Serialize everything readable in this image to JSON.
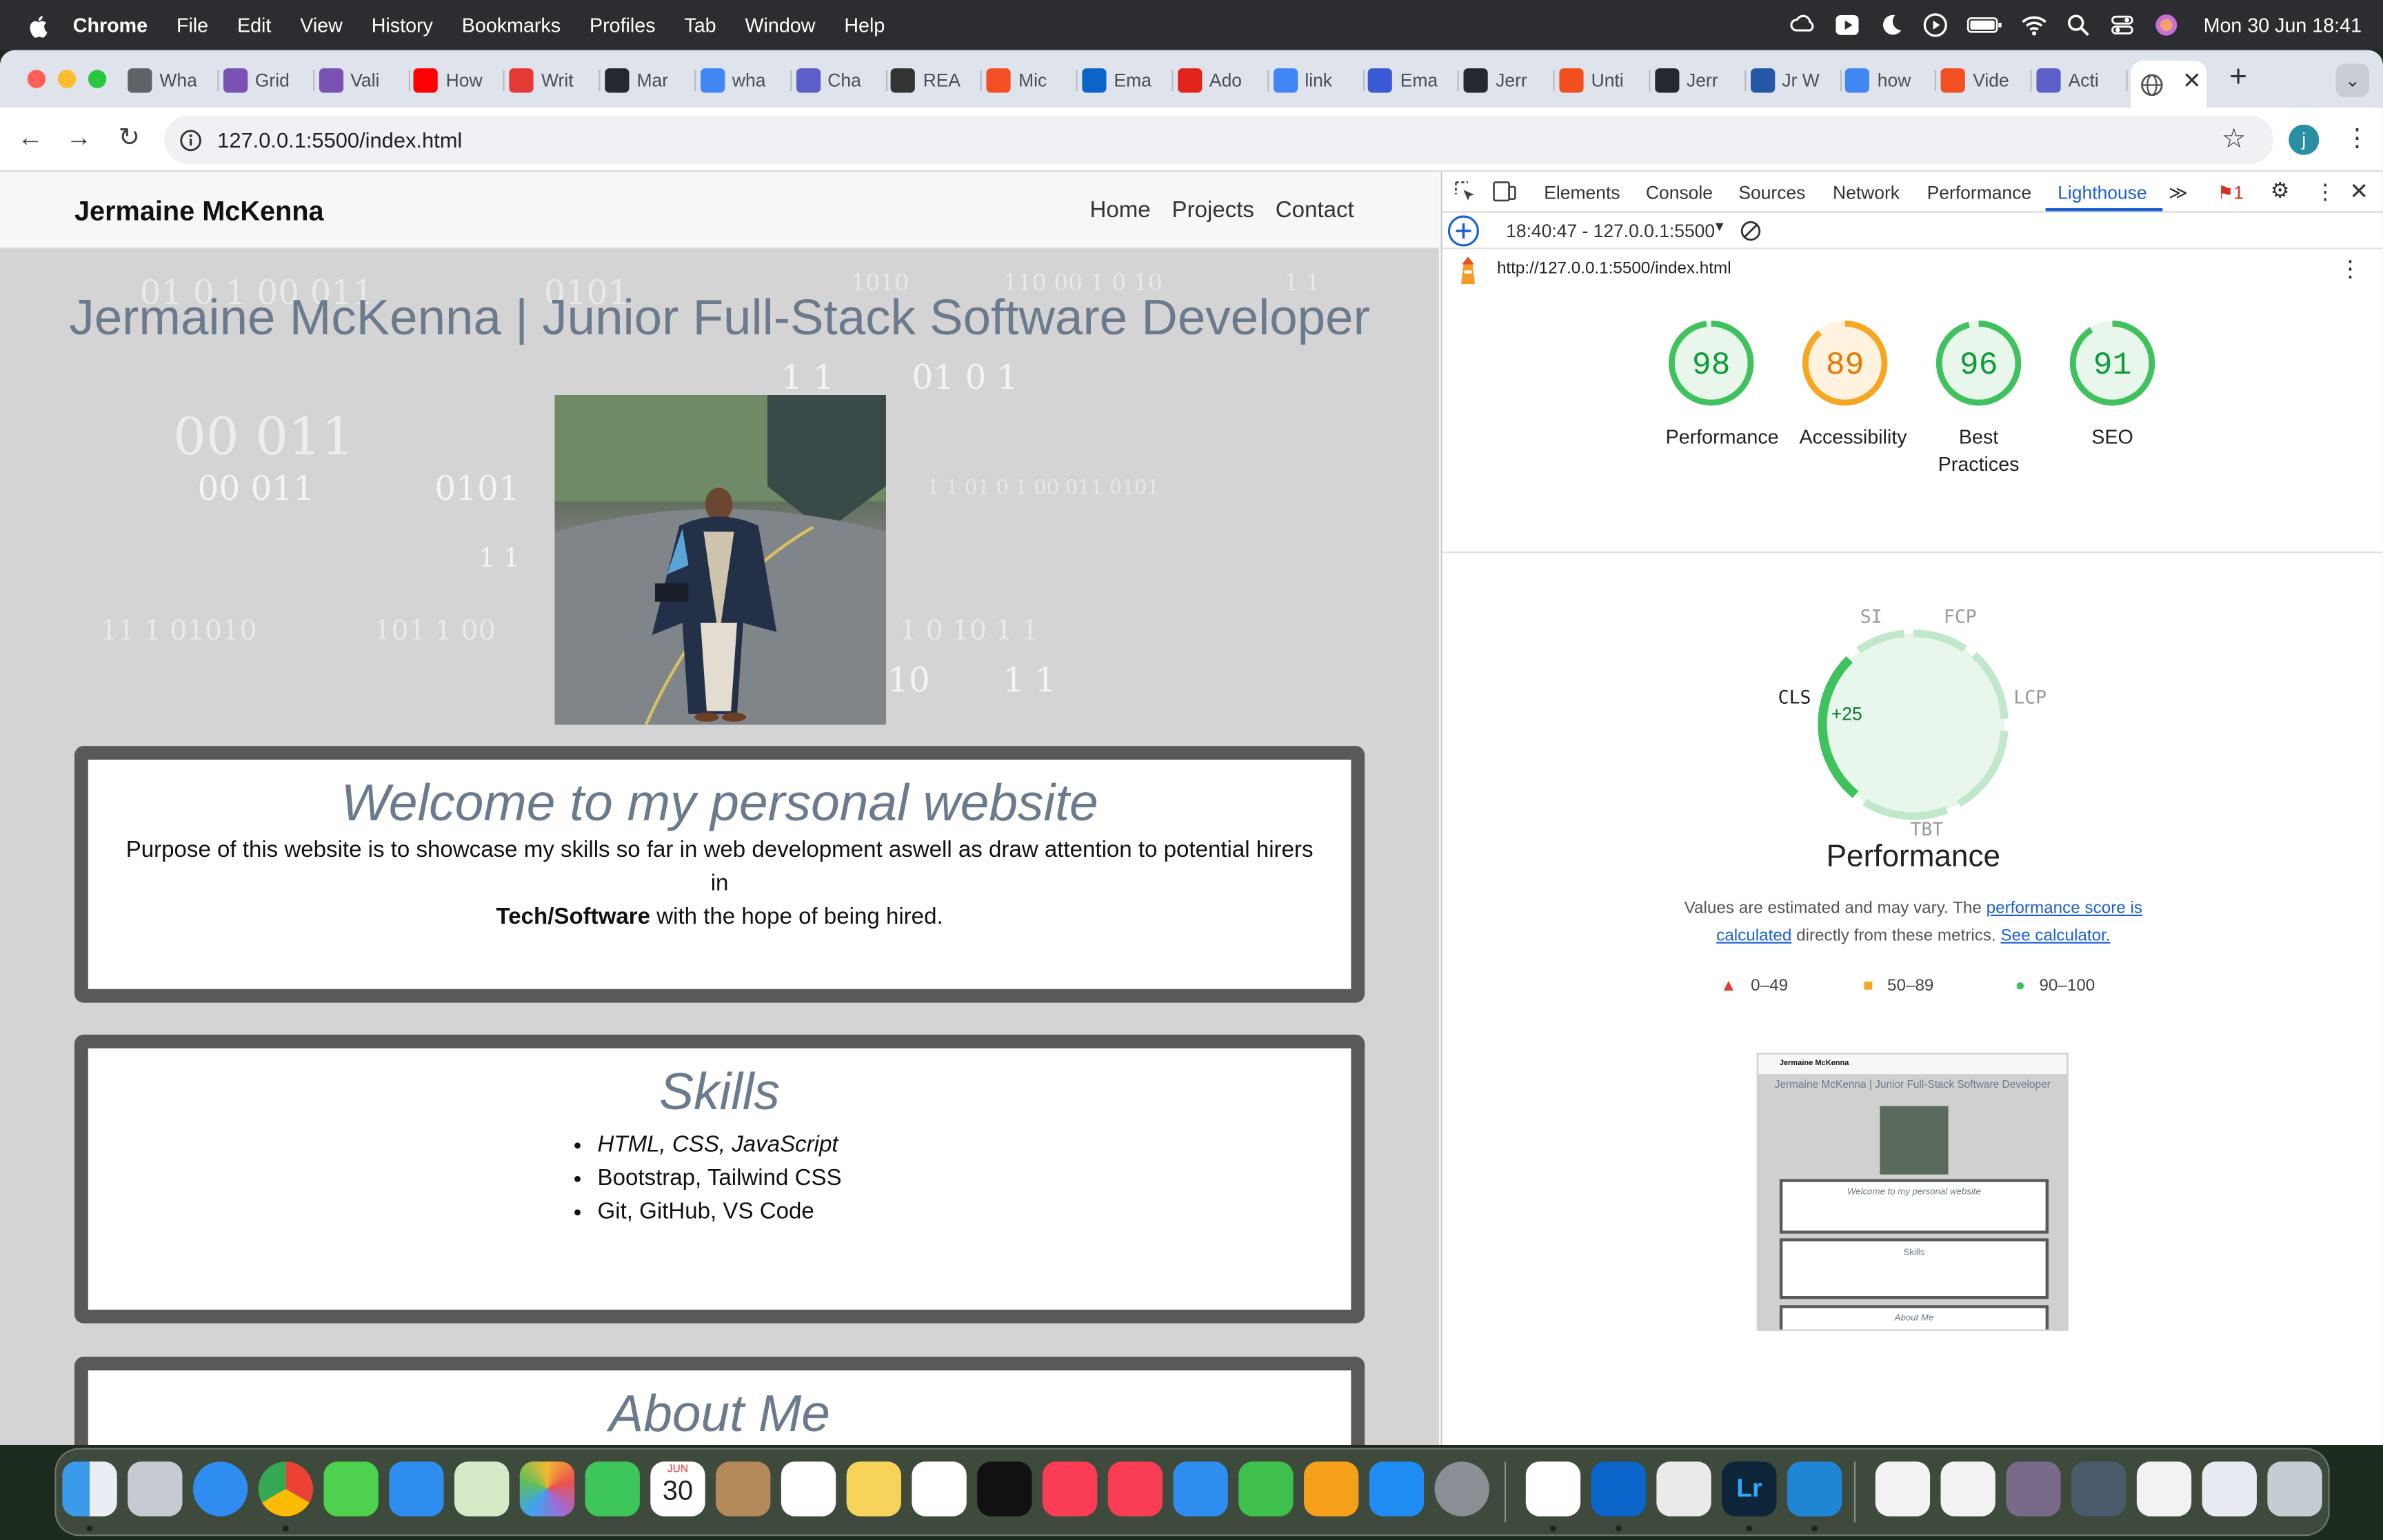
{
  "menubar": {
    "app": "Chrome",
    "items": [
      "File",
      "Edit",
      "View",
      "History",
      "Bookmarks",
      "Profiles",
      "Tab",
      "Window",
      "Help"
    ],
    "clock": "Mon 30 Jun  18:41"
  },
  "tabs": [
    {
      "label": "Wha",
      "icon": "chrome-icon",
      "color": "#5f6368"
    },
    {
      "label": "Grid",
      "icon": "bootstrap-icon",
      "color": "#7952b3"
    },
    {
      "label": "Vali",
      "icon": "bootstrap-icon",
      "color": "#7952b3"
    },
    {
      "label": "How",
      "icon": "youtube-icon",
      "color": "#ff0000"
    },
    {
      "label": "Writ",
      "icon": "opera-icon",
      "color": "#e53935"
    },
    {
      "label": "Mar",
      "icon": "github-icon",
      "color": "#24292f"
    },
    {
      "label": "wha",
      "icon": "google-icon",
      "color": "#4285f4"
    },
    {
      "label": "Cha",
      "icon": "teams-icon",
      "color": "#5b5fc7"
    },
    {
      "label": "REA",
      "icon": "wikipedia-icon",
      "color": "#333"
    },
    {
      "label": "Mic",
      "icon": "microsoft-icon",
      "color": "#f25022"
    },
    {
      "label": "Ema",
      "icon": "outlook-icon",
      "color": "#0a64c9"
    },
    {
      "label": "Ado",
      "icon": "adobe-icon",
      "color": "#e1251b"
    },
    {
      "label": "link",
      "icon": "google-icon",
      "color": "#4285f4"
    },
    {
      "label": "Ema",
      "icon": "forms-icon",
      "color": "#3b5bd6"
    },
    {
      "label": "Jerr",
      "icon": "github-icon",
      "color": "#24292f"
    },
    {
      "label": "Unti",
      "icon": "figma-icon",
      "color": "#f24e1e"
    },
    {
      "label": "Jerr",
      "icon": "github-icon",
      "color": "#24292f"
    },
    {
      "label": "Jr W",
      "icon": "indeed-icon",
      "color": "#2557a7"
    },
    {
      "label": "how",
      "icon": "google-icon",
      "color": "#4285f4"
    },
    {
      "label": "Vide",
      "icon": "microsoft-icon",
      "color": "#f25022"
    },
    {
      "label": "Acti",
      "icon": "teams-icon",
      "color": "#5b5fc7"
    }
  ],
  "url": "127.0.0.1:5500/index.html",
  "avatar_letter": "j",
  "site": {
    "brand": "Jermaine McKenna",
    "nav": [
      "Home",
      "Projects",
      "Contact"
    ],
    "hero_title": "Jermaine McKenna | Junior Full-Stack Software Developer",
    "welcome_title": "Welcome to my personal website",
    "welcome_text_1": "Purpose of this website is to showcase my skills so far in web development aswell as draw attention to potential hirers in",
    "welcome_bold": "Tech/Software",
    "welcome_text_2": " with the hope of being hired.",
    "skills_title": "Skills",
    "skills": [
      "HTML, CSS, JavaScript",
      "Bootstrap, Tailwind CSS",
      "Git, GitHub, VS Code"
    ],
    "about_title": "About Me"
  },
  "devtools": {
    "tabs": [
      "Elements",
      "Console",
      "Sources",
      "Network",
      "Performance",
      "Lighthouse"
    ],
    "active_tab": "Lighthouse",
    "issues": "1",
    "report": "18:40:47 - 127.0.0.1:5500",
    "audited_url": "http://127.0.0.1:5500/index.html",
    "scores": [
      {
        "value": 98,
        "label": "Performance",
        "color": "#0c9d37"
      },
      {
        "value": 89,
        "label": "Accessibility",
        "color": "#e67700"
      },
      {
        "value": 96,
        "label": "Best Practices",
        "color": "#0c9d37"
      },
      {
        "value": 91,
        "label": "SEO",
        "color": "#0c9d37"
      }
    ],
    "metrics": {
      "si": "SI",
      "fcp": "FCP",
      "lcp": "LCP",
      "tbt": "TBT",
      "cls": "CLS",
      "delta": "+25"
    },
    "perf_title": "Performance",
    "note_1": "Values are estimated and may vary. The ",
    "note_link_1": "performance score is calculated",
    "note_2": " directly from these metrics. ",
    "note_link_2": "See calculator.",
    "legend": [
      "0–49",
      "50–89",
      "90–100"
    ],
    "thumb": {
      "brand": "Jermaine McKenna",
      "title": "Jermaine McKenna | Junior Full-Stack Software Developer",
      "welcome": "Welcome to my personal website",
      "skills": "Skills",
      "about": "About Me"
    }
  },
  "dock": {
    "calendar_month": "JUN",
    "calendar_day": "30"
  }
}
